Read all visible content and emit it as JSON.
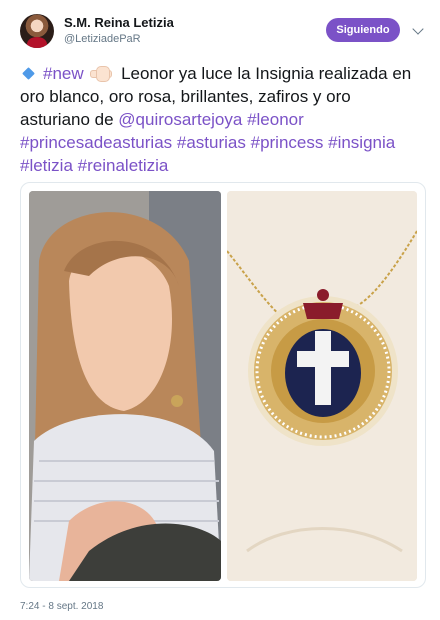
{
  "header": {
    "name": "S.M. Reina Letizia",
    "handle": "@LetiziadePaR",
    "follow_label": "Siguiendo"
  },
  "tweet": {
    "tag_new": "#new",
    "text_1": " Leonor ya luce la Insignia realizada en oro blanco, oro rosa, brillantes, zafiros y oro asturiano de ",
    "mention": "@quirosartejoya",
    "hashtags": [
      "#leonor",
      "#princesadeasturias",
      "#asturias",
      "#princess",
      "#insignia",
      "#letizia",
      "#reinaletizia"
    ]
  },
  "media": {
    "photos": [
      "girl-photo",
      "pendant-photo"
    ]
  },
  "footer": {
    "timestamp": "7:24 - 8 sept. 2018"
  },
  "colors": {
    "accent": "#7b52c7",
    "text": "#14171a",
    "muted": "#657786",
    "border": "#e1e8ed"
  },
  "icons": [
    "avatar",
    "chevron-down-icon",
    "blue-diamond-icon",
    "hand-emoji-icon"
  ]
}
